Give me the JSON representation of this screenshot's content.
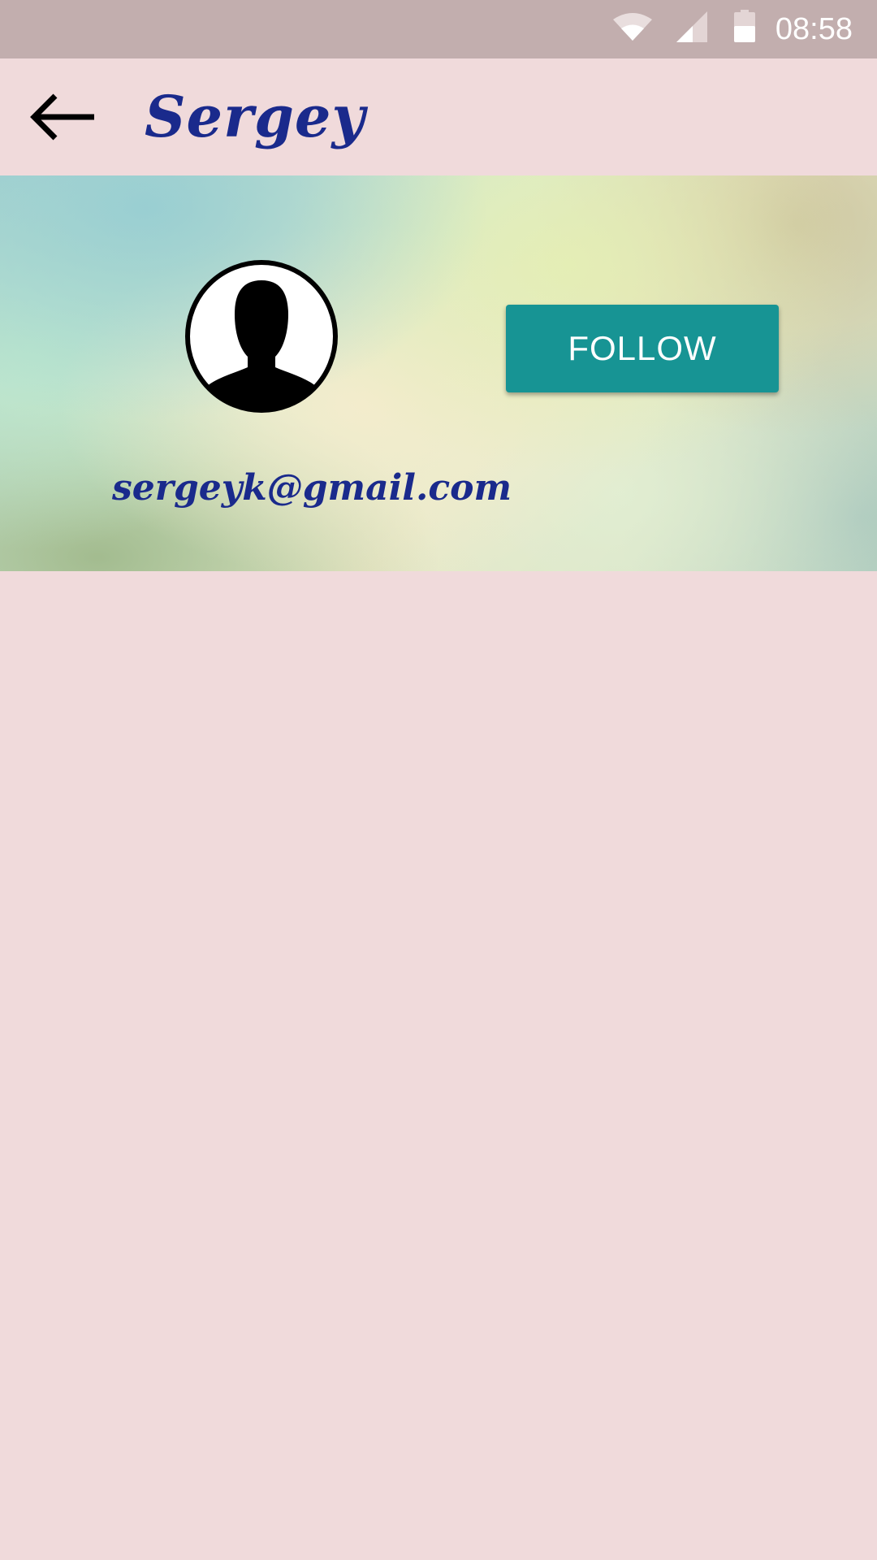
{
  "status_bar": {
    "time": "08:58",
    "icons": [
      "wifi-icon",
      "cell-signal-icon",
      "battery-icon"
    ]
  },
  "app_bar": {
    "back_icon": "arrow-left-icon",
    "title": "Sergey"
  },
  "profile": {
    "avatar_icon": "person-silhouette-icon",
    "follow_label": "FOLLOW",
    "email": "sergeyk@gmail.com"
  },
  "colors": {
    "background": "#f0dadb",
    "status_bar": "#c2aeae",
    "title_text": "#1a2a8c",
    "follow_button": "#179494"
  }
}
